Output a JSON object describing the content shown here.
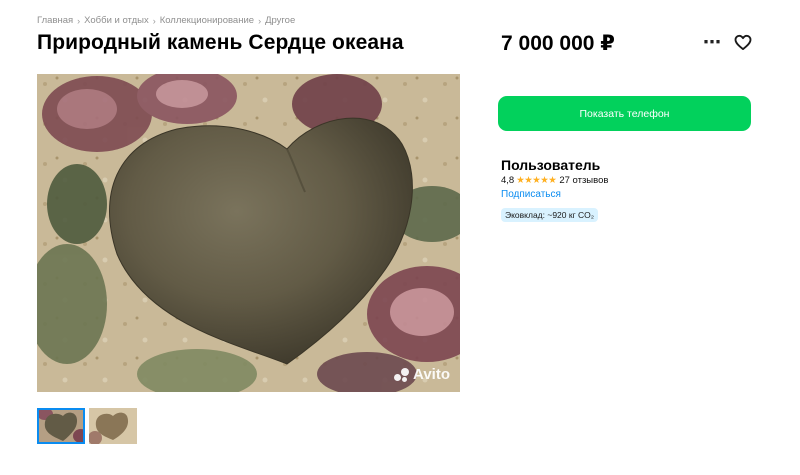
{
  "breadcrumb": [
    "Главная",
    "Хобби и отдых",
    "Коллекционирование",
    "Другое"
  ],
  "title": "Природный камень Сердце океана",
  "price": "7 000 000 ₽",
  "icons": {
    "more": "more-dots-icon",
    "favorite": "heart-outline-icon",
    "separator": "chevron-right-icon"
  },
  "gallery": {
    "watermark": "Avito",
    "thumbnail_count": 2,
    "active_thumbnail": 1
  },
  "actions": {
    "show_phone": "Показать телефон"
  },
  "seller": {
    "name": "Пользователь",
    "rating": "4,8",
    "stars": 5,
    "reviews": "27 отзывов",
    "subscribe": "Подписаться",
    "eco_badge": "Эковклад: ~920 кг CO₂"
  },
  "colors": {
    "accent_green": "#02d15c",
    "link_blue": "#0a8cf0",
    "star": "#ffb021",
    "badge_bg": "#d9f2ff"
  }
}
